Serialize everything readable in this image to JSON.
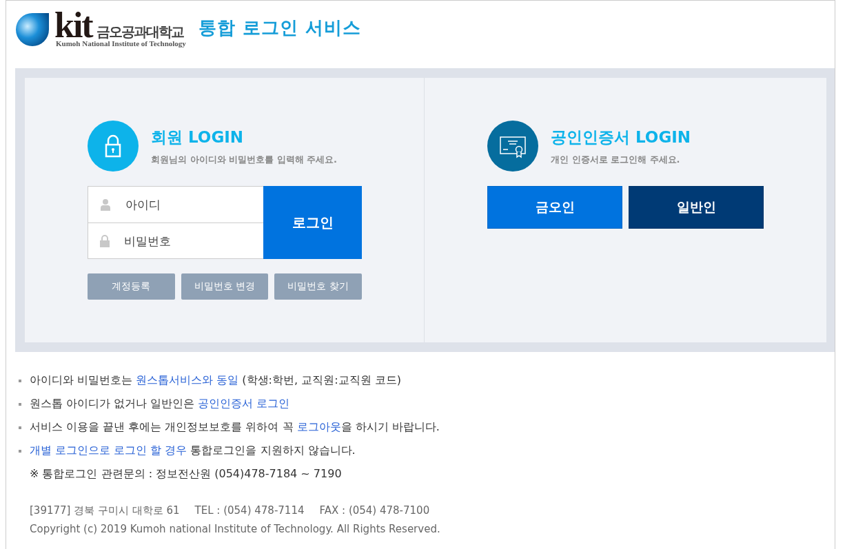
{
  "header": {
    "logo_mark": "kit",
    "logo_korean": "금오공과대학교",
    "logo_english": "Kumoh National Institute of Technology",
    "title": "통합 로그인 서비스"
  },
  "member_login": {
    "title": "회원 LOGIN",
    "subtitle": "회원님의 아이디와 비밀번호를 입력해 주세요.",
    "id_placeholder": "아이디",
    "password_placeholder": "비밀번호",
    "login_button": "로그인",
    "links": [
      "계정등록",
      "비밀번호 변경",
      "비밀번호 찾기"
    ]
  },
  "certificate_login": {
    "title": "공인인증서 LOGIN",
    "subtitle": "개인 인증서로 로그인해 주세요.",
    "buttons": [
      {
        "label": "금오인",
        "color": "#0073df"
      },
      {
        "label": "일반인",
        "color": "#003a75"
      }
    ]
  },
  "notes": [
    {
      "kind": "bullet",
      "parts": [
        {
          "text": "아이디와 비밀번호는 ",
          "link": false
        },
        {
          "text": "원스톱서비스와 동일",
          "link": true
        },
        {
          "text": " (학생:학번, 교직원:교직원 코드)",
          "link": false
        }
      ]
    },
    {
      "kind": "bullet",
      "parts": [
        {
          "text": "원스톱 아이디가 없거나 일반인은 ",
          "link": false
        },
        {
          "text": "공인인증서 로그인",
          "link": true
        }
      ]
    },
    {
      "kind": "bullet",
      "parts": [
        {
          "text": "서비스 이용을 끝낸 후에는 개인정보보호를 위하여 꼭 ",
          "link": false
        },
        {
          "text": "로그아웃",
          "link": true
        },
        {
          "text": "을 하시기 바랍니다.",
          "link": false
        }
      ]
    },
    {
      "kind": "bullet",
      "parts": [
        {
          "text": "개별 로그인으로 로그인 할 경우",
          "link": true
        },
        {
          "text": " 통합로그인을 지원하지 않습니다.",
          "link": false
        }
      ]
    },
    {
      "kind": "plain",
      "parts": [
        {
          "text": "※ 통합로그인 관련문의 : 정보전산원 (054)478-7184 ~ 7190",
          "link": false
        }
      ]
    }
  ],
  "footer": {
    "address": "[39177] 경북 구미시 대학로 61",
    "tel": "TEL : (054) 478-7114",
    "fax": "FAX : (054) 478-7100",
    "copyright": "Copyright (c) 2019 Kumoh national Institute of Technology. All Rights Reserved."
  }
}
